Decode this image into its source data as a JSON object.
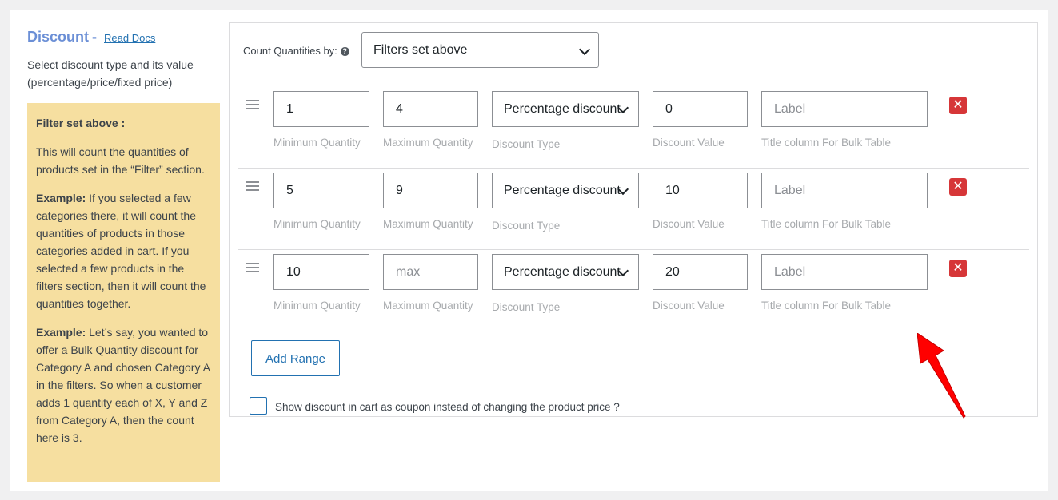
{
  "sidebar": {
    "title": "Discount",
    "separator": "-",
    "read_docs": "Read Docs",
    "description": "Select discount type and its value (percentage/price/fixed price)",
    "note": {
      "heading": "Filter set above :",
      "para1": "This will count the quantities of products set in the “Filter” section.",
      "example1_label": "Example:",
      "example1_text": " If you selected a few categories there, it will count the quantities of products in those categories added in cart. If you selected a few products in the filters section, then it will count the quantities together.",
      "example2_label": "Example:",
      "example2_text": " Let’s say, you wanted to offer a Bulk Quantity discount for Category A and chosen Category A in the filters. So when a customer adds 1 quantity each of X, Y and Z from Category A, then the count here is 3."
    }
  },
  "count": {
    "label": "Count Quantities by:",
    "help_icon": "?",
    "selected": "Filters set above"
  },
  "labels": {
    "min": "Minimum Quantity",
    "max": "Maximum Quantity",
    "type": "Discount Type",
    "value": "Discount Value",
    "title": "Title column For Bulk Table"
  },
  "rows": [
    {
      "min": "1",
      "max": "4",
      "max_placeholder": "",
      "type": "Percentage discount",
      "value": "0",
      "title_placeholder": "Label"
    },
    {
      "min": "5",
      "max": "9",
      "max_placeholder": "",
      "type": "Percentage discount",
      "value": "10",
      "title_placeholder": "Label"
    },
    {
      "min": "10",
      "max": "",
      "max_placeholder": "max",
      "type": "Percentage discount",
      "value": "20",
      "title_placeholder": "Label"
    }
  ],
  "delete_symbol": "✕",
  "add_range": "Add Range",
  "coupon_checkbox": {
    "checked": false,
    "label": "Show discount in cart as coupon instead of changing the product price ?"
  },
  "colors": {
    "accent": "#2271b1",
    "title": "#6b8fd6",
    "note_bg": "#f6dfa0",
    "delete": "#d63638",
    "annotation_arrow": "#ff0000"
  }
}
